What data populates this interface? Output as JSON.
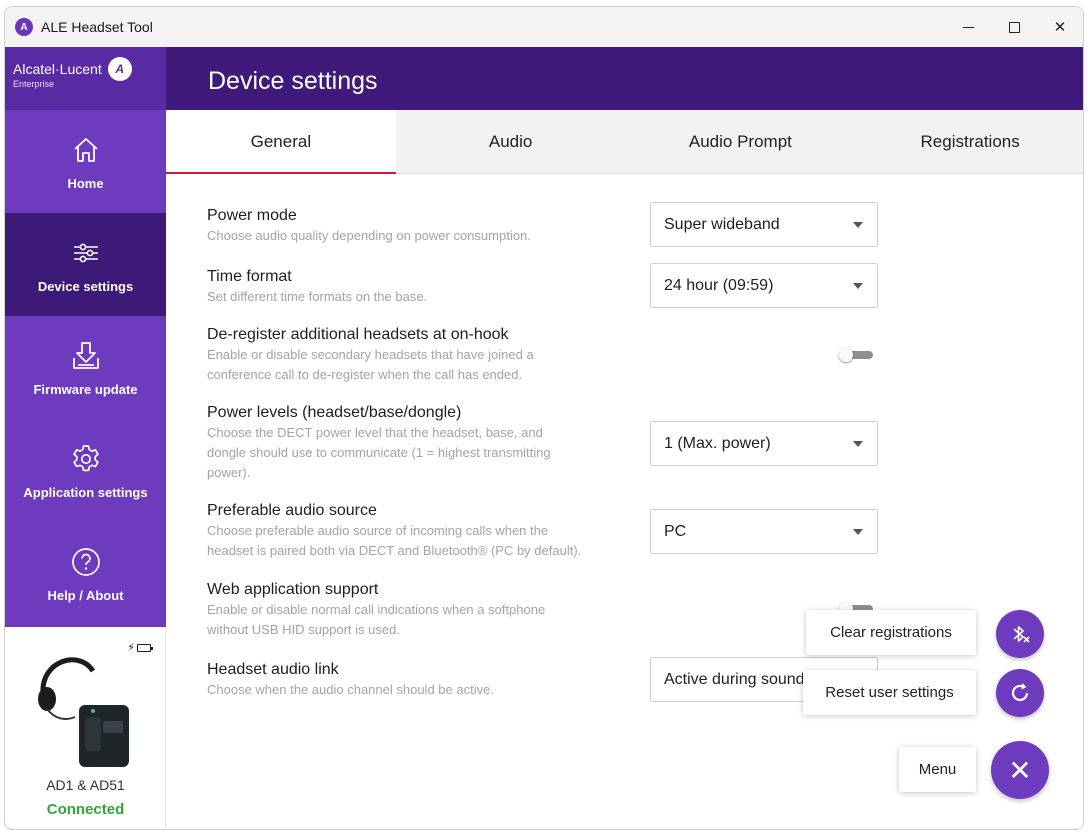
{
  "window": {
    "title": "ALE Headset Tool",
    "app_icon": "ale-app-icon",
    "controls": [
      "minimize",
      "maximize",
      "close"
    ],
    "close_glyph": "✕"
  },
  "brand": {
    "name": "Alcatel·Lucent",
    "sub": "Enterprise",
    "logo_glyph": "A"
  },
  "sidebar": {
    "items": [
      {
        "label": "Home",
        "icon": "home-icon",
        "active": false
      },
      {
        "label": "Device settings",
        "icon": "sliders-icon",
        "active": true
      },
      {
        "label": "Firmware update",
        "icon": "download-icon",
        "active": false
      },
      {
        "label": "Application settings",
        "icon": "gear-icon",
        "active": false
      },
      {
        "label": "Help / About",
        "icon": "help-icon",
        "active": false
      }
    ]
  },
  "device": {
    "name": "AD1 & AD51",
    "status": "Connected",
    "battery_bolt": "⚡"
  },
  "header": {
    "title": "Device settings"
  },
  "tabs": [
    {
      "label": "General",
      "active": true
    },
    {
      "label": "Audio",
      "active": false
    },
    {
      "label": "Audio Prompt",
      "active": false
    },
    {
      "label": "Registrations",
      "active": false
    }
  ],
  "settings": [
    {
      "title": "Power mode",
      "desc": "Choose audio quality depending on power consumption.",
      "control": "select",
      "value": "Super wideband"
    },
    {
      "title": "Time format",
      "desc": "Set different time formats on the base.",
      "control": "select",
      "value": "24 hour (09:59)"
    },
    {
      "title": "De-register additional headsets at on-hook",
      "desc_lines": [
        "Enable or disable secondary headsets that have joined a",
        "conference call to de-register when the call has ended."
      ],
      "control": "toggle",
      "on": false
    },
    {
      "title": "Power levels (headset/base/dongle)",
      "desc_lines": [
        "Choose the DECT power level that the headset, base, and",
        "dongle should use to communicate (1 = highest transmitting",
        "power)."
      ],
      "control": "select",
      "value": "1 (Max. power)"
    },
    {
      "title": "Preferable audio source",
      "desc_lines": [
        "Choose preferable audio source of incoming calls when the",
        "headset is paired both via DECT and Bluetooth® (PC by default)."
      ],
      "control": "select",
      "value": "PC"
    },
    {
      "title": "Web application support",
      "desc_lines": [
        "Enable or disable normal call indications when a softphone",
        "without USB HID support is used."
      ],
      "control": "toggle",
      "on": false
    },
    {
      "title": "Headset audio link",
      "desc": "Choose when the audio channel should be active.",
      "control": "select",
      "value": "Active during sound"
    }
  ],
  "fab_menu": {
    "clear_label": "Clear registrations",
    "reset_label": "Reset user settings",
    "menu_label": "Menu",
    "menu_glyph": "✕",
    "icons": [
      "bluetooth-clear-icon",
      "refresh-icon",
      "close-icon"
    ],
    "accent": "#6e3bbe"
  },
  "colors": {
    "sidebar": "#6e3bbe",
    "header": "#3f1a7a",
    "sidebar_active": "#3e1a78",
    "tab_underline": "#d6163b",
    "connected": "#31a436"
  }
}
